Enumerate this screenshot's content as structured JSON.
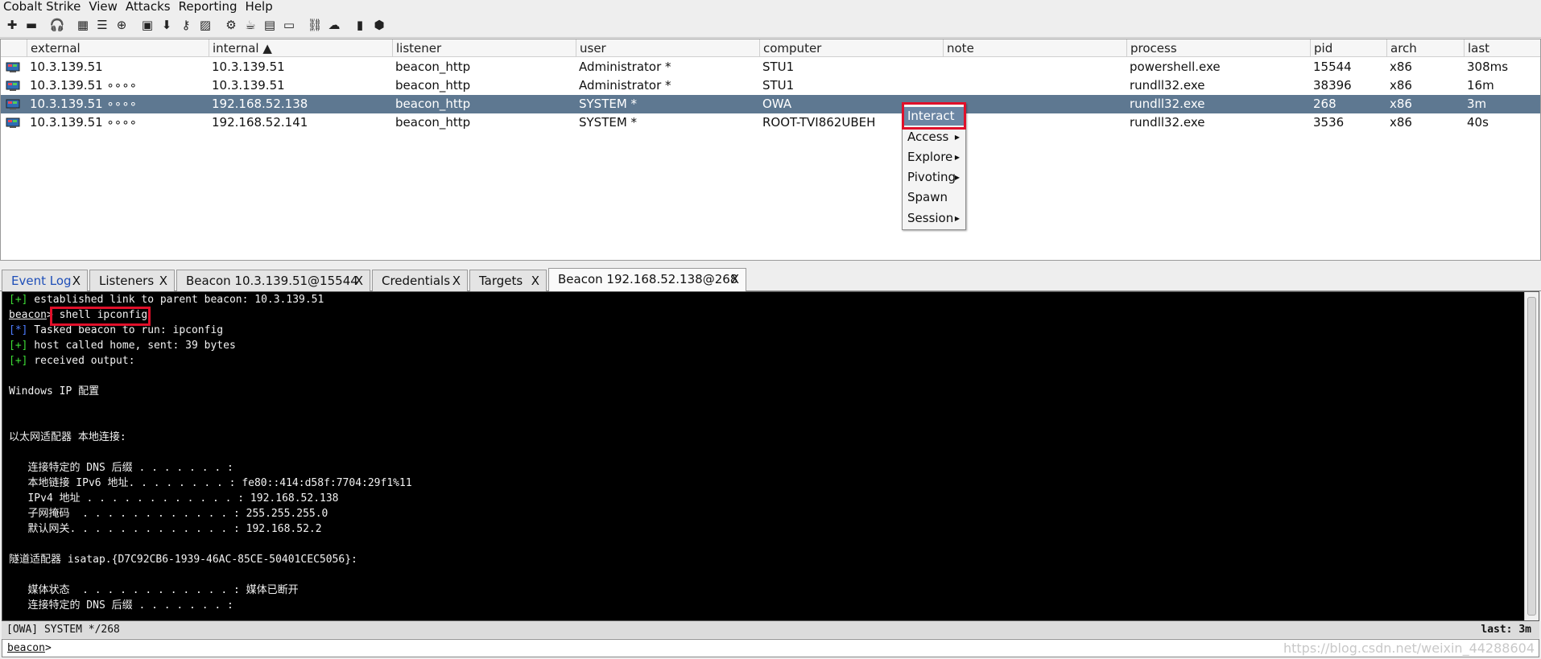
{
  "menubar": [
    "Cobalt Strike",
    "View",
    "Attacks",
    "Reporting",
    "Help"
  ],
  "table": {
    "columns": [
      "external",
      "internal ▲",
      "listener",
      "user",
      "computer",
      "note",
      "process",
      "pid",
      "arch",
      "last"
    ],
    "rows": [
      {
        "external": "10.3.139.51",
        "internal": "10.3.139.51",
        "listener": "beacon_http",
        "user": "Administrator *",
        "computer": "STU1",
        "note": "",
        "process": "powershell.exe",
        "pid": "15544",
        "arch": "x86",
        "last": "308ms"
      },
      {
        "external": "10.3.139.51 ∘∘∘∘",
        "internal": "10.3.139.51",
        "listener": "beacon_http",
        "user": "Administrator *",
        "computer": "STU1",
        "note": "",
        "process": "rundll32.exe",
        "pid": "38396",
        "arch": "x86",
        "last": "16m"
      },
      {
        "external": "10.3.139.51 ∘∘∘∘",
        "internal": "192.168.52.138",
        "listener": "beacon_http",
        "user": "SYSTEM *",
        "computer": "OWA",
        "note": "",
        "process": "rundll32.exe",
        "pid": "268",
        "arch": "x86",
        "last": "3m"
      },
      {
        "external": "10.3.139.51 ∘∘∘∘",
        "internal": "192.168.52.141",
        "listener": "beacon_http",
        "user": "SYSTEM *",
        "computer": "ROOT-TVI862UBEH",
        "note": "",
        "process": "rundll32.exe",
        "pid": "3536",
        "arch": "x86",
        "last": "40s"
      }
    ]
  },
  "context_menu": [
    "Interact",
    "Access",
    "Explore",
    "Pivoting",
    "Spawn",
    "Session"
  ],
  "tabs": [
    "Event Log",
    "Listeners",
    "Beacon 10.3.139.51@15544",
    "Credentials",
    "Targets",
    "Beacon 192.168.52.138@268"
  ],
  "tab_close": "X",
  "console": {
    "line1_tag": "[+]",
    "line1_text": " established link to parent beacon: 10.3.139.51",
    "prompt_name": "beacon",
    "prompt_sep": "> ",
    "command": "shell ipconfig",
    "line3_tag": "[*]",
    "line3_text": " Tasked beacon to run: ipconfig",
    "line4_tag": "[+]",
    "line4_text": " host called home, sent: 39 bytes",
    "line5_tag": "[+]",
    "line5_text": " received output:",
    "out": [
      "Windows IP 配置",
      "以太网适配器 本地连接:",
      "   连接特定的 DNS 后缀 . . . . . . . :",
      "   本地链接 IPv6 地址. . . . . . . . : fe80::414:d58f:7704:29f1%11",
      "   IPv4 地址 . . . . . . . . . . . . : 192.168.52.138",
      "   子网掩码  . . . . . . . . . . . . : 255.255.255.0",
      "   默认网关. . . . . . . . . . . . . : 192.168.52.2",
      "隧道适配器 isatap.{D7C92CB6-1939-46AC-85CE-50401CEC5056}:",
      "   媒体状态  . . . . . . . . . . . . : 媒体已断开",
      "   连接特定的 DNS 后缀 . . . . . . . :"
    ]
  },
  "status": {
    "left": "[OWA] SYSTEM */268",
    "right": "last: 3m"
  },
  "input": {
    "prompt": "beacon",
    "sep": ">"
  },
  "watermark": "https://blog.csdn.net/weixin_44288604",
  "colors": {
    "selected_row": "#5e7891",
    "highlight_box": "#e0102a",
    "green_tag": "#3ddc35",
    "blue_tag": "#4d7cff"
  }
}
